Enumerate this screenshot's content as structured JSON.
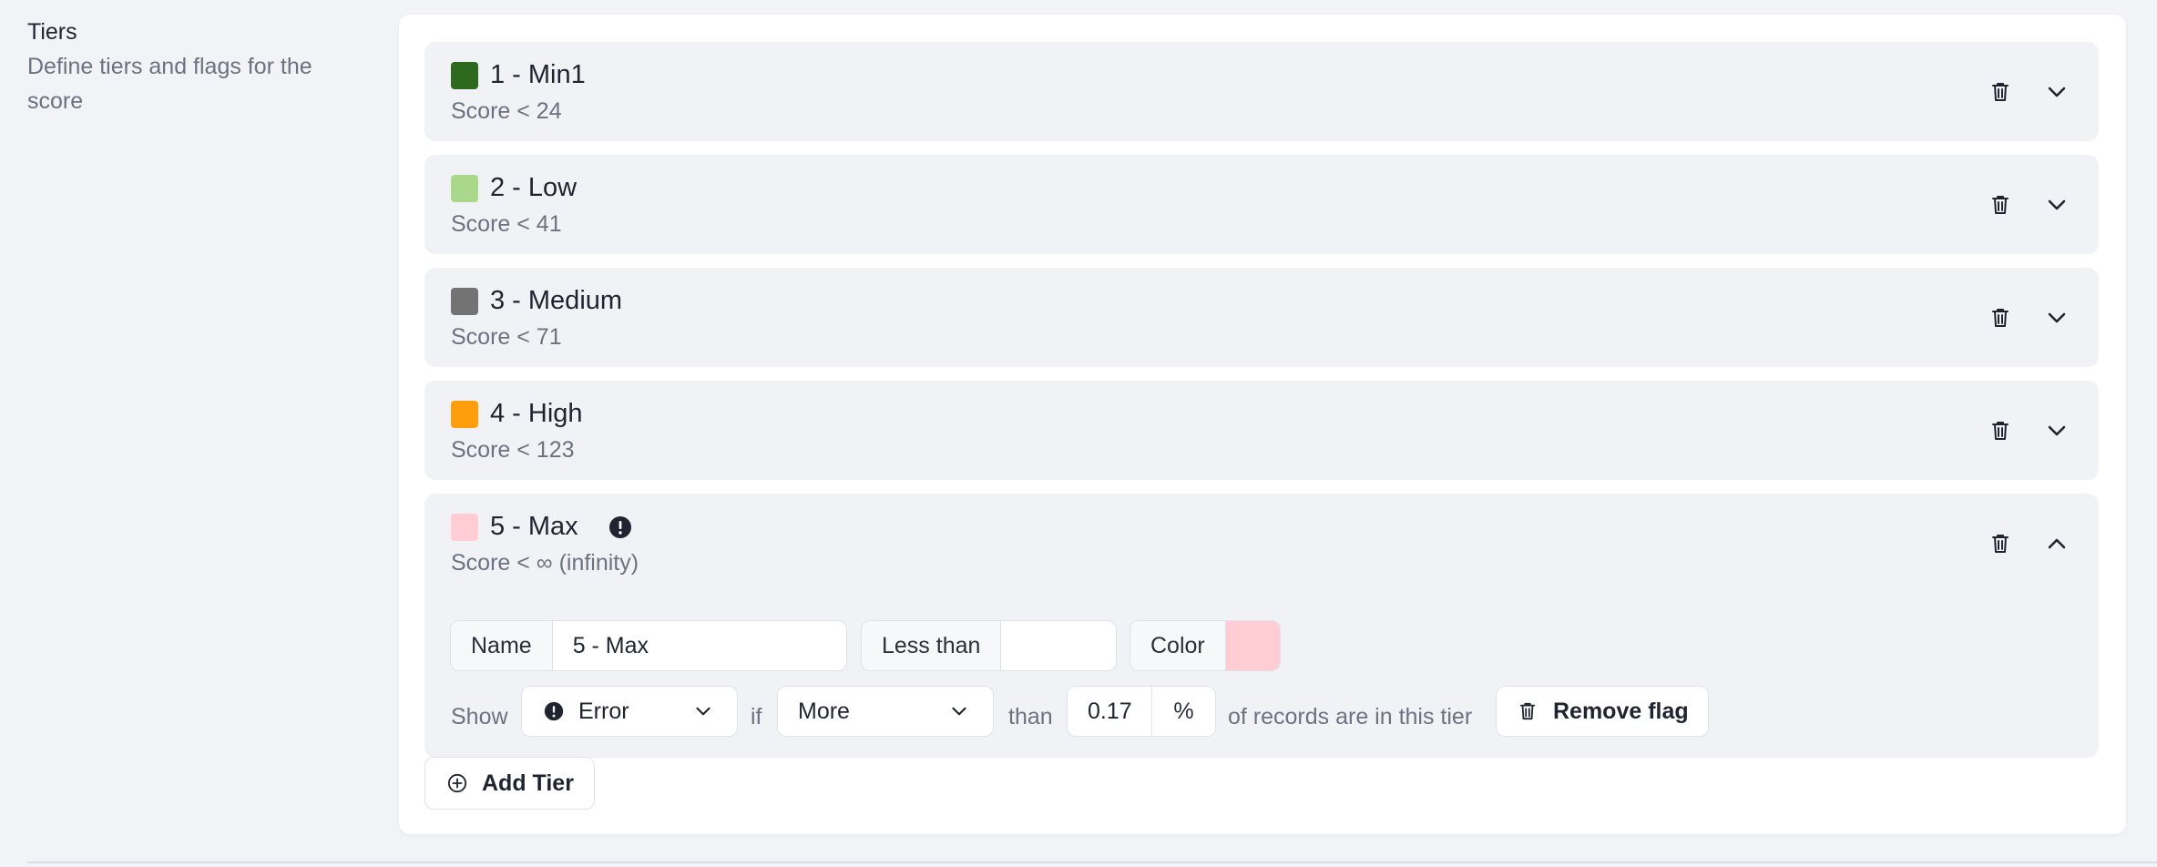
{
  "section": {
    "title": "Tiers",
    "description": "Define tiers and flags for the score"
  },
  "colors": {
    "tier1": "#2d6a1f",
    "tier2": "#a9d88a",
    "tier3": "#737373",
    "tier4": "#ff9e0c",
    "tier5": "#ffcdd3"
  },
  "tiers": [
    {
      "name": "1 - Min1",
      "score": "Score < 24",
      "color": "#2d6a1f",
      "expanded": false
    },
    {
      "name": "2 - Low",
      "score": "Score < 41",
      "color": "#a9d88a",
      "expanded": false
    },
    {
      "name": "3 - Medium",
      "score": "Score < 71",
      "color": "#737373",
      "expanded": false
    },
    {
      "name": "4 - High",
      "score": "Score < 123",
      "color": "#ff9e0c",
      "expanded": false
    },
    {
      "name": "5 - Max",
      "score": "Score < ∞ (infinity)",
      "color": "#ffcdd3",
      "expanded": true,
      "has_flag_icon": "alert-circle-icon"
    }
  ],
  "editor": {
    "name_label": "Name",
    "name_value": "5 - Max",
    "less_than_label": "Less than",
    "less_than_value": "",
    "color_label": "Color",
    "color_value": "#ffcdd3"
  },
  "flag": {
    "show_label": "Show",
    "level_value": "Error",
    "if_label": "if",
    "comparison_value": "More",
    "than_label": "than",
    "percent_value": "0.17",
    "percent_unit": "%",
    "suffix": "of records are in this tier",
    "remove_label": "Remove flag"
  },
  "add_tier_label": "Add Tier"
}
